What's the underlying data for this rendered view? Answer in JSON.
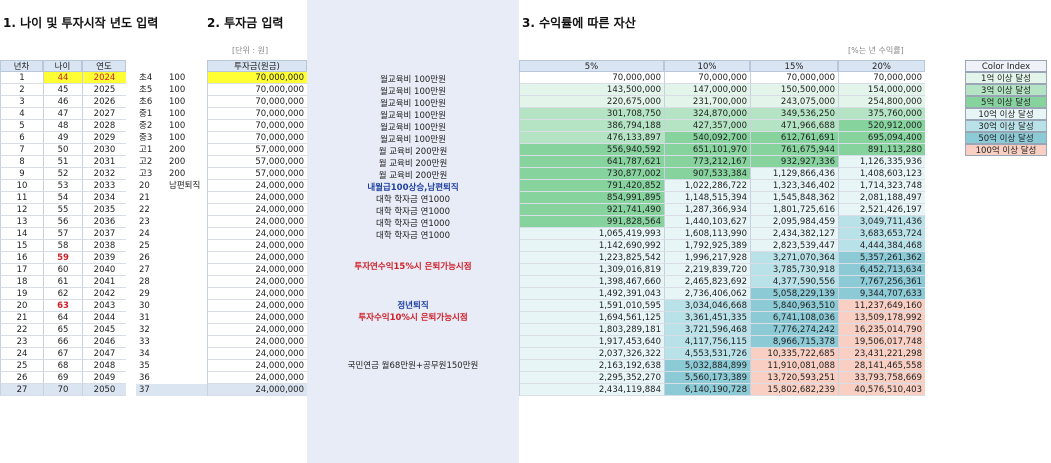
{
  "sections": {
    "s1": "1. 나이 및 투자시작 년도 입력",
    "s2": "2. 투자금 입력",
    "s3": "3. 수익률에 따른 자산"
  },
  "units": {
    "won": "[단위 : 원]",
    "rate": "[%는 년 수익률]"
  },
  "headers": {
    "year": "년차",
    "age": "나이",
    "yr": "연도",
    "invest": "투자금(원금)",
    "r5": "5%",
    "r10": "10%",
    "r15": "15%",
    "r20": "20%"
  },
  "legend": {
    "title": "Color Index",
    "items": [
      {
        "label": "1억 이상 달성",
        "color": "#e3f5ea"
      },
      {
        "label": "3억 이상 달성",
        "color": "#b4e4c3"
      },
      {
        "label": "5억 이상 달성",
        "color": "#86d39e"
      },
      {
        "label": "10억 이상 달성",
        "color": "#e8f5f7"
      },
      {
        "label": "30억 이상 달성",
        "color": "#b9e1e8"
      },
      {
        "label": "50억 이상 달성",
        "color": "#8ccad6"
      },
      {
        "label": "100억 이상 달성",
        "color": "#f8cfc2"
      }
    ]
  },
  "notes": {
    "n1": "월교육비 100만원",
    "n2": "월 교육비 200만원",
    "n3": "내월급100상승,남편퇴직",
    "n4": "대학 학자금 연1000",
    "n5": "투자연수익15%시 은퇴가능시점",
    "n6": "정년퇴직",
    "n7": "투자수익10%시 은퇴가능시점",
    "n8": "국민연금 월68만원+공무원150만원"
  },
  "rows": [
    {
      "n": "1",
      "age": "44",
      "year": "2024",
      "g": "초4",
      "a": "100",
      "inv": "70,000,000",
      "v5": "70,000,000",
      "v10": "70,000,000",
      "v15": "70,000,000",
      "v20": "70,000,000"
    },
    {
      "n": "2",
      "age": "45",
      "year": "2025",
      "g": "초5",
      "a": "100",
      "inv": "70,000,000",
      "v5": "143,500,000",
      "v10": "147,000,000",
      "v15": "150,500,000",
      "v20": "154,000,000"
    },
    {
      "n": "3",
      "age": "46",
      "year": "2026",
      "g": "초6",
      "a": "100",
      "inv": "70,000,000",
      "v5": "220,675,000",
      "v10": "231,700,000",
      "v15": "243,075,000",
      "v20": "254,800,000"
    },
    {
      "n": "4",
      "age": "47",
      "year": "2027",
      "g": "중1",
      "a": "100",
      "inv": "70,000,000",
      "v5": "301,708,750",
      "v10": "324,870,000",
      "v15": "349,536,250",
      "v20": "375,760,000"
    },
    {
      "n": "5",
      "age": "48",
      "year": "2028",
      "g": "중2",
      "a": "100",
      "inv": "70,000,000",
      "v5": "386,794,188",
      "v10": "427,357,000",
      "v15": "471,966,688",
      "v20": "520,912,000"
    },
    {
      "n": "6",
      "age": "49",
      "year": "2029",
      "g": "중3",
      "a": "100",
      "inv": "70,000,000",
      "v5": "476,133,897",
      "v10": "540,092,700",
      "v15": "612,761,691",
      "v20": "695,094,400"
    },
    {
      "n": "7",
      "age": "50",
      "year": "2030",
      "g": "고1",
      "a": "200",
      "inv": "57,000,000",
      "v5": "556,940,592",
      "v10": "651,101,970",
      "v15": "761,675,944",
      "v20": "891,113,280"
    },
    {
      "n": "8",
      "age": "51",
      "year": "2031",
      "g": "고2",
      "a": "200",
      "inv": "57,000,000",
      "v5": "641,787,621",
      "v10": "773,212,167",
      "v15": "932,927,336",
      "v20": "1,126,335,936"
    },
    {
      "n": "9",
      "age": "52",
      "year": "2032",
      "g": "고3",
      "a": "200",
      "inv": "57,000,000",
      "v5": "730,877,002",
      "v10": "907,533,384",
      "v15": "1,129,866,436",
      "v20": "1,408,603,123"
    },
    {
      "n": "10",
      "age": "53",
      "year": "2033",
      "g": "20",
      "a": "남편퇴직",
      "inv": "24,000,000",
      "v5": "791,420,852",
      "v10": "1,022,286,722",
      "v15": "1,323,346,402",
      "v20": "1,714,323,748"
    },
    {
      "n": "11",
      "age": "54",
      "year": "2034",
      "g": "21",
      "a": "",
      "inv": "24,000,000",
      "v5": "854,991,895",
      "v10": "1,148,515,394",
      "v15": "1,545,848,362",
      "v20": "2,081,188,497"
    },
    {
      "n": "12",
      "age": "55",
      "year": "2035",
      "g": "22",
      "a": "",
      "inv": "24,000,000",
      "v5": "921,741,490",
      "v10": "1,287,366,934",
      "v15": "1,801,725,616",
      "v20": "2,521,426,197"
    },
    {
      "n": "13",
      "age": "56",
      "year": "2036",
      "g": "23",
      "a": "",
      "inv": "24,000,000",
      "v5": "991,828,564",
      "v10": "1,440,103,627",
      "v15": "2,095,984,459",
      "v20": "3,049,711,436"
    },
    {
      "n": "14",
      "age": "57",
      "year": "2037",
      "g": "24",
      "a": "",
      "inv": "24,000,000",
      "v5": "1,065,419,993",
      "v10": "1,608,113,990",
      "v15": "2,434,382,127",
      "v20": "3,683,653,724"
    },
    {
      "n": "15",
      "age": "58",
      "year": "2038",
      "g": "25",
      "a": "",
      "inv": "24,000,000",
      "v5": "1,142,690,992",
      "v10": "1,792,925,389",
      "v15": "2,823,539,447",
      "v20": "4,444,384,468"
    },
    {
      "n": "16",
      "age": "59",
      "year": "2039",
      "g": "26",
      "a": "",
      "inv": "24,000,000",
      "v5": "1,223,825,542",
      "v10": "1,996,217,928",
      "v15": "3,271,070,364",
      "v20": "5,357,261,362"
    },
    {
      "n": "17",
      "age": "60",
      "year": "2040",
      "g": "27",
      "a": "",
      "inv": "24,000,000",
      "v5": "1,309,016,819",
      "v10": "2,219,839,720",
      "v15": "3,785,730,918",
      "v20": "6,452,713,634"
    },
    {
      "n": "18",
      "age": "61",
      "year": "2041",
      "g": "28",
      "a": "",
      "inv": "24,000,000",
      "v5": "1,398,467,660",
      "v10": "2,465,823,692",
      "v15": "4,377,590,556",
      "v20": "7,767,256,361"
    },
    {
      "n": "19",
      "age": "62",
      "year": "2042",
      "g": "29",
      "a": "",
      "inv": "24,000,000",
      "v5": "1,492,391,043",
      "v10": "2,736,406,062",
      "v15": "5,058,229,139",
      "v20": "9,344,707,633"
    },
    {
      "n": "20",
      "age": "63",
      "year": "2043",
      "g": "30",
      "a": "",
      "inv": "24,000,000",
      "v5": "1,591,010,595",
      "v10": "3,034,046,668",
      "v15": "5,840,963,510",
      "v20": "11,237,649,160"
    },
    {
      "n": "21",
      "age": "64",
      "year": "2044",
      "g": "31",
      "a": "",
      "inv": "24,000,000",
      "v5": "1,694,561,125",
      "v10": "3,361,451,335",
      "v15": "6,741,108,036",
      "v20": "13,509,178,992"
    },
    {
      "n": "22",
      "age": "65",
      "year": "2045",
      "g": "32",
      "a": "",
      "inv": "24,000,000",
      "v5": "1,803,289,181",
      "v10": "3,721,596,468",
      "v15": "7,776,274,242",
      "v20": "16,235,014,790"
    },
    {
      "n": "23",
      "age": "66",
      "year": "2046",
      "g": "33",
      "a": "",
      "inv": "24,000,000",
      "v5": "1,917,453,640",
      "v10": "4,117,756,115",
      "v15": "8,966,715,378",
      "v20": "19,506,017,748"
    },
    {
      "n": "24",
      "age": "67",
      "year": "2047",
      "g": "34",
      "a": "",
      "inv": "24,000,000",
      "v5": "2,037,326,322",
      "v10": "4,553,531,726",
      "v15": "10,335,722,685",
      "v20": "23,431,221,298"
    },
    {
      "n": "25",
      "age": "68",
      "year": "2048",
      "g": "35",
      "a": "",
      "inv": "24,000,000",
      "v5": "2,163,192,638",
      "v10": "5,032,884,899",
      "v15": "11,910,081,088",
      "v20": "28,141,465,558"
    },
    {
      "n": "26",
      "age": "69",
      "year": "2049",
      "g": "36",
      "a": "",
      "inv": "24,000,000",
      "v5": "2,295,352,270",
      "v10": "5,560,173,389",
      "v15": "13,720,593,251",
      "v20": "33,793,758,669"
    },
    {
      "n": "27",
      "age": "70",
      "year": "2050",
      "g": "37",
      "a": "",
      "inv": "24,000,000",
      "v5": "2,434,119,884",
      "v10": "6,140,190,728",
      "v15": "15,802,682,239",
      "v20": "40,576,510,403"
    }
  ]
}
